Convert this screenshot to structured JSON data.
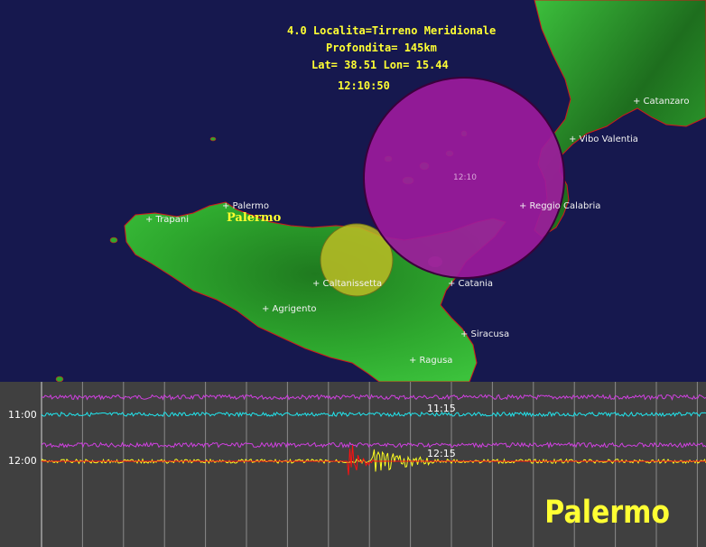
{
  "event": {
    "line1": "4.0 Localita=Tirreno Meridionale",
    "line2": "Profondita= 145km",
    "line3": "Lat= 38.51 Lon= 15.44",
    "line4": "12:10:50",
    "magnitude": 4.0,
    "depth_km": 145,
    "lat": 38.51,
    "lon": 15.44
  },
  "map": {
    "circle_label": "12:10",
    "circle_color": "#9c1b9c",
    "secondary_circle_color": "#bcbc25",
    "land_color": "#2ea82e",
    "sea_color": "#16184e",
    "highlight_city": "Palermo",
    "cities": [
      {
        "id": "catanzaro",
        "name": "+ Catanzaro"
      },
      {
        "id": "vibo-valentia",
        "name": "+ Vibo Valentia"
      },
      {
        "id": "reggio-calabria",
        "name": "+ Reggio Calabria"
      },
      {
        "id": "palermo",
        "name": "+ Palermo"
      },
      {
        "id": "trapani",
        "name": "+ Trapani"
      },
      {
        "id": "caltanissetta",
        "name": "+ Caltanissetta"
      },
      {
        "id": "catania",
        "name": "+ Catania"
      },
      {
        "id": "agrigento",
        "name": "+ Agrigento"
      },
      {
        "id": "siracusa",
        "name": "+ Siracusa"
      },
      {
        "id": "ragusa",
        "name": "+ Ragusa"
      }
    ]
  },
  "seismogram": {
    "station": "Palermo",
    "rows": [
      {
        "label": "11:00",
        "trace_time": "11:15",
        "color": "#20e6ee",
        "overlay_color": "#d040e0"
      },
      {
        "label": "12:00",
        "trace_time": "12:15",
        "color": "#ffff20",
        "overlay_color": "#d040e0",
        "event_color": "#ff1010"
      }
    ]
  }
}
